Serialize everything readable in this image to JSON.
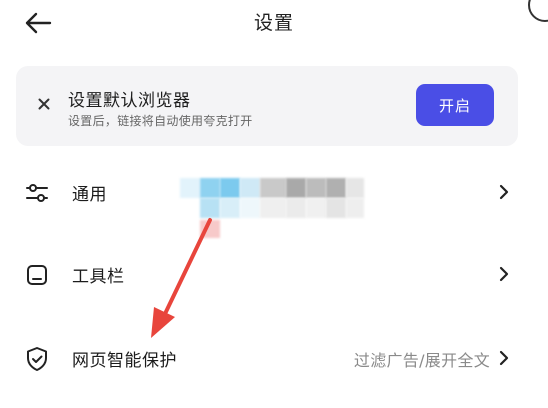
{
  "header": {
    "title": "设置",
    "back_icon": "arrow-left-icon"
  },
  "banner": {
    "title": "设置默认浏览器",
    "subtitle": "设置后，链接将自动使用夸克打开",
    "button_label": "开启",
    "close_icon": "close-icon",
    "button_color": "#4a4ee6"
  },
  "settings": {
    "items": [
      {
        "label": "通用",
        "icon": "sliders-icon",
        "value": ""
      },
      {
        "label": "工具栏",
        "icon": "toolbar-icon",
        "value": ""
      },
      {
        "label": "网页智能保护",
        "icon": "shield-check-icon",
        "value": "过滤广告/展开全文"
      }
    ]
  },
  "annotation": {
    "arrow_color": "#e8453c"
  }
}
